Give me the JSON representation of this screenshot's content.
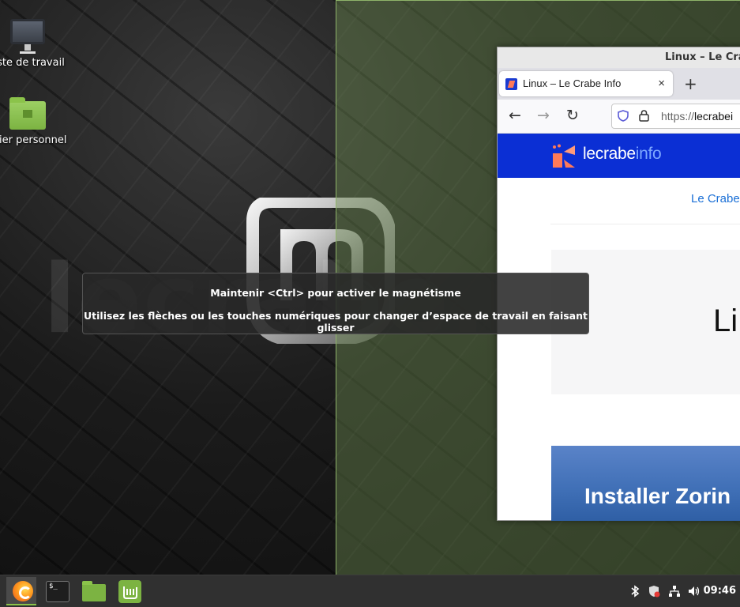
{
  "desktop": {
    "icons": [
      {
        "label": "oste de travail"
      },
      {
        "label": "ssier personnel"
      }
    ],
    "watermark": "lecrabe.info"
  },
  "browser": {
    "window_title": "Linux – Le Crab",
    "tab_title": "Linux – Le Crabe Info",
    "tab_close": "×",
    "new_tab": "+",
    "url_prefix": "https://",
    "url_host": "lecrabei",
    "site": {
      "logo_text": "lecrabe",
      "logo_accent": "info",
      "breadcrumb": "Le Crabe",
      "hero_title": "Li",
      "post_title": "Installer Zorin"
    }
  },
  "osd": {
    "line1": "Maintenir <Ctrl> pour activer le magnétisme",
    "line2": "Utilisez les flèches ou les touches numériques pour changer d’espace de travail en faisant glisser"
  },
  "panel": {
    "launchers": [
      {
        "name": "firefox-icon"
      },
      {
        "name": "terminal-icon",
        "glyph": "$_"
      },
      {
        "name": "files-icon"
      },
      {
        "name": "mint-update-icon"
      }
    ],
    "tray": [
      "bluetooth-icon",
      "shield-update-icon",
      "network-icon",
      "volume-icon"
    ],
    "clock": "09:46"
  },
  "colors": {
    "mint_green": "#8bc34a",
    "site_blue": "#0b2fd4",
    "snap_overlay": "#6e8c50",
    "panel_bg": "#303030"
  }
}
